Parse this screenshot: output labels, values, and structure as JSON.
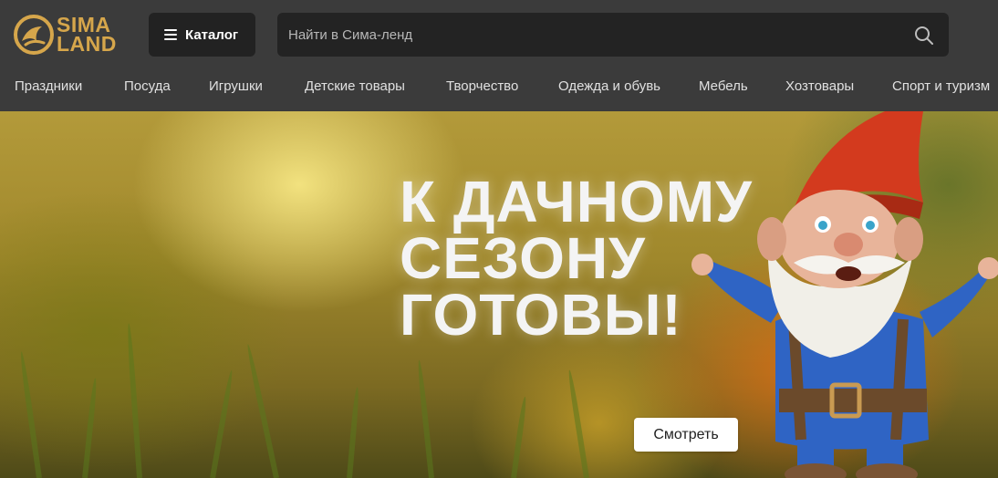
{
  "logo": {
    "line1": "SIMA",
    "line2": "LAND"
  },
  "catalog_button": {
    "label": "Каталог"
  },
  "search": {
    "placeholder": "Найти в Сима-ленд"
  },
  "nav": [
    "Праздники",
    "Посуда",
    "Игрушки",
    "Детские товары",
    "Творчество",
    "Одежда и обувь",
    "Мебель",
    "Хозтовары",
    "Спорт и туризм"
  ],
  "banner": {
    "headline": [
      "К ДАЧНОМУ",
      "СЕЗОНУ",
      "ГОТОВЫ!"
    ],
    "cta_label": "Смотреть"
  },
  "colors": {
    "header_bg": "#3b3b3b",
    "search_bg": "#232323",
    "logo_gold": "#d6a64b"
  }
}
